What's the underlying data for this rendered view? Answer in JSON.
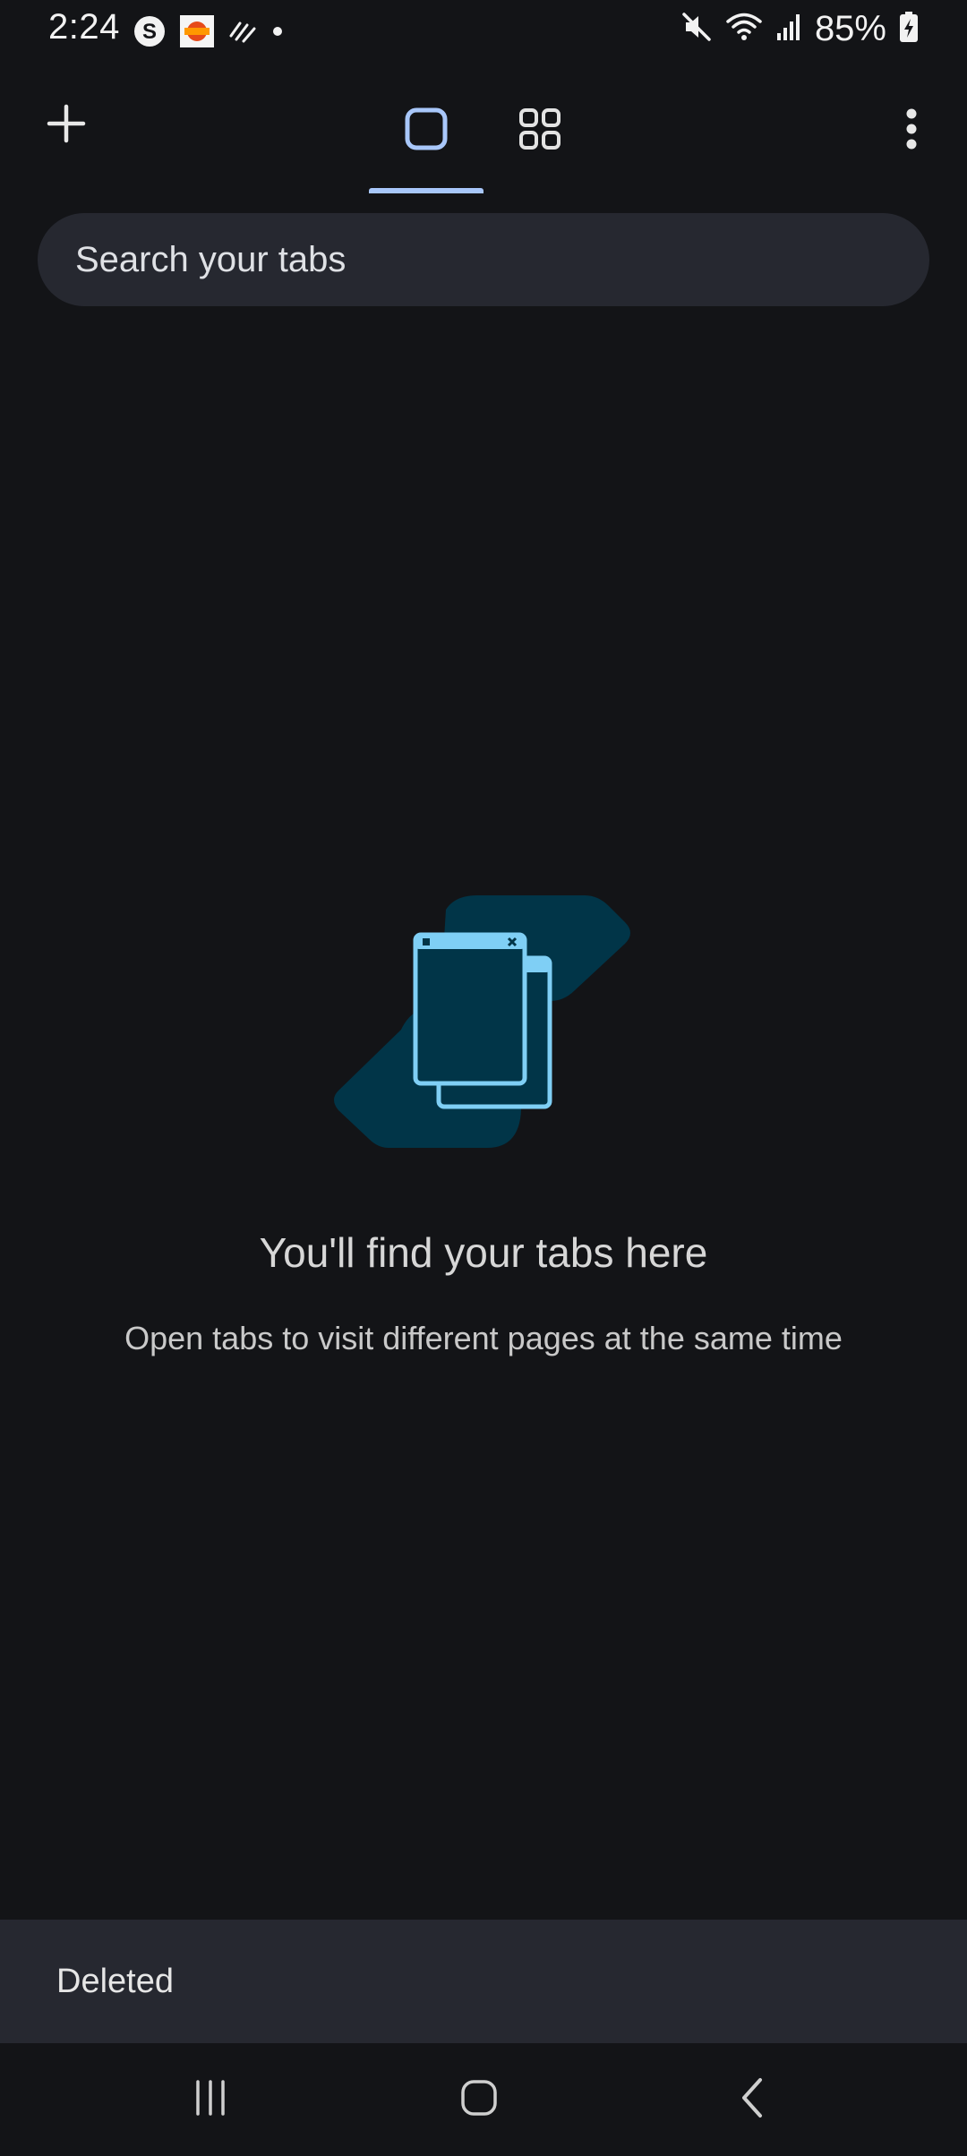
{
  "status_bar": {
    "time": "2:24",
    "battery": "85%",
    "icons": [
      "s-app-icon",
      "news-app-icon",
      "data-saver-icon",
      "dot-icon",
      "mute-icon",
      "wifi-icon",
      "signal-icon",
      "battery-charging-icon"
    ]
  },
  "toolbar": {
    "new_tab_icon": "plus-icon",
    "tabs": [
      {
        "icon": "single-tab-icon",
        "selected": true
      },
      {
        "icon": "tab-groups-icon",
        "selected": false
      }
    ],
    "menu_icon": "more-vertical-icon",
    "accent_color": "#a8c7fa"
  },
  "search": {
    "placeholder": "Search your tabs"
  },
  "empty_state": {
    "illustration": "tabs-illustration",
    "title": "You'll find your tabs here",
    "subtitle": "Open tabs to visit different pages at the same time"
  },
  "snackbar": {
    "message": "Deleted"
  },
  "nav_bar": {
    "icons": [
      "recents-icon",
      "home-icon",
      "back-icon"
    ]
  }
}
